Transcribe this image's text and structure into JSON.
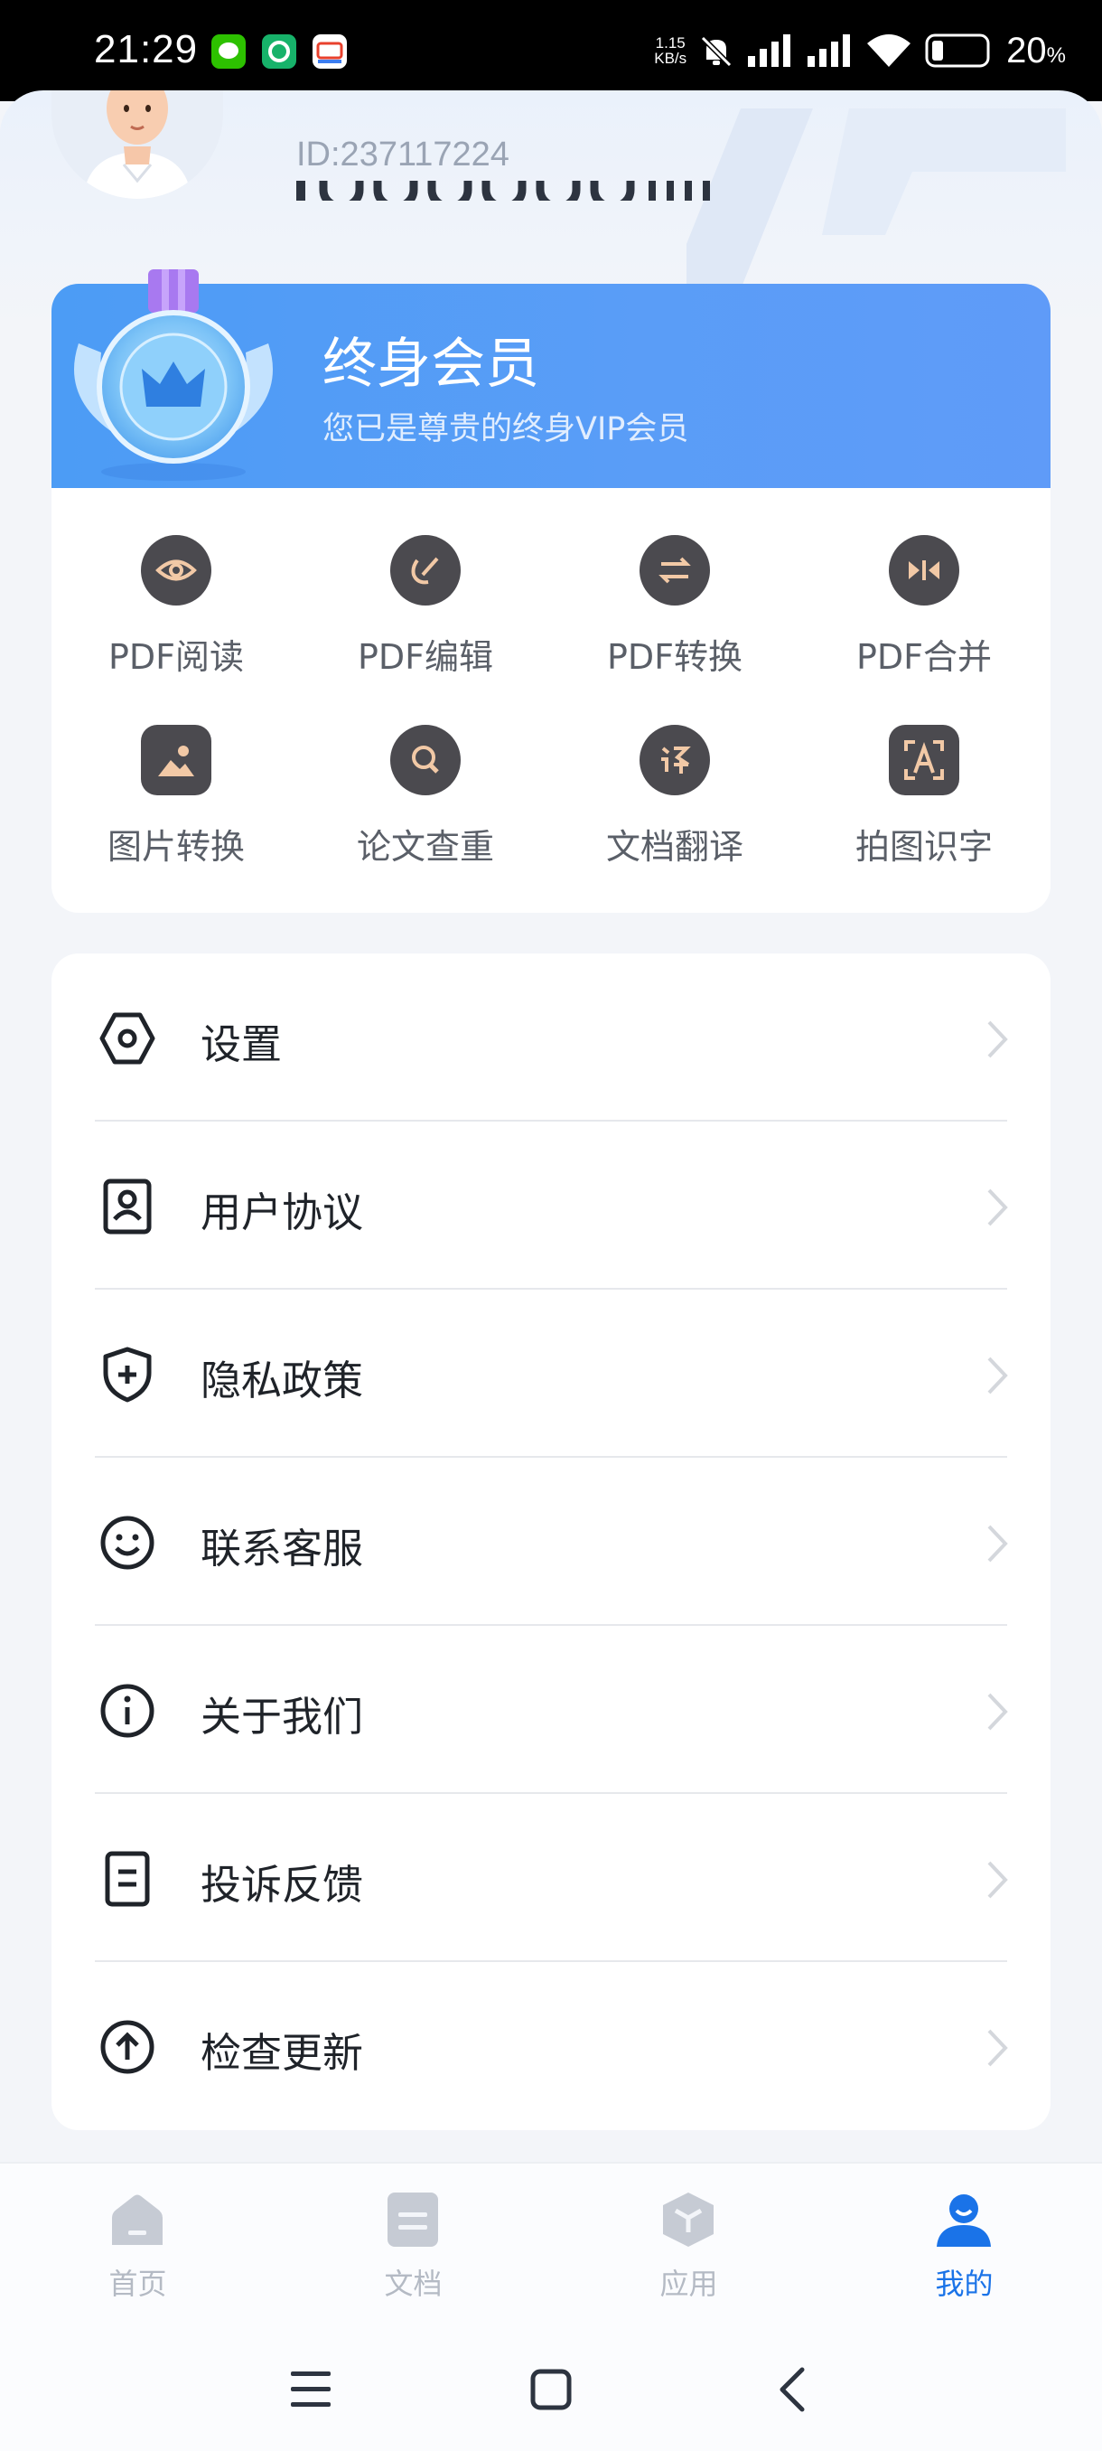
{
  "status_bar": {
    "time": "21:29",
    "net_speed_value": "1.15",
    "net_speed_unit": "KB/s",
    "battery_percent": "20",
    "battery_unit": "%"
  },
  "profile": {
    "user_id": "ID:237117224"
  },
  "vip": {
    "title": "终身会员",
    "subtitle": "您已是尊贵的终身VIP会员"
  },
  "tools": [
    {
      "label": "PDF阅读",
      "icon": "eye-icon"
    },
    {
      "label": "PDF编辑",
      "icon": "edit-icon"
    },
    {
      "label": "PDF转换",
      "icon": "swap-arrows-icon"
    },
    {
      "label": "PDF合并",
      "icon": "merge-icon"
    },
    {
      "label": "图片转换",
      "icon": "image-icon"
    },
    {
      "label": "论文查重",
      "icon": "magnifier-icon"
    },
    {
      "label": "文档翻译",
      "icon": "translate-icon"
    },
    {
      "label": "拍图识字",
      "icon": "text-scan-icon"
    }
  ],
  "menu": [
    {
      "label": "设置",
      "icon": "settings-hexagon-icon"
    },
    {
      "label": "用户协议",
      "icon": "user-card-icon"
    },
    {
      "label": "隐私政策",
      "icon": "shield-plus-icon"
    },
    {
      "label": "联系客服",
      "icon": "smiley-icon"
    },
    {
      "label": "关于我们",
      "icon": "info-icon"
    },
    {
      "label": "投诉反馈",
      "icon": "document-icon"
    },
    {
      "label": "检查更新",
      "icon": "upload-arrow-icon"
    }
  ],
  "tabbar": [
    {
      "label": "首页",
      "icon": "home-icon",
      "active": false
    },
    {
      "label": "文档",
      "icon": "document-icon",
      "active": false
    },
    {
      "label": "应用",
      "icon": "apps-cube-icon",
      "active": false
    },
    {
      "label": "我的",
      "icon": "user-icon",
      "active": true
    }
  ],
  "colors": {
    "accent": "#1a73e8",
    "vip_gradient_start": "#4c9cf5",
    "tool_icon_bg": "#4b4a4f",
    "tool_icon_fg": "#f2c9a6"
  }
}
